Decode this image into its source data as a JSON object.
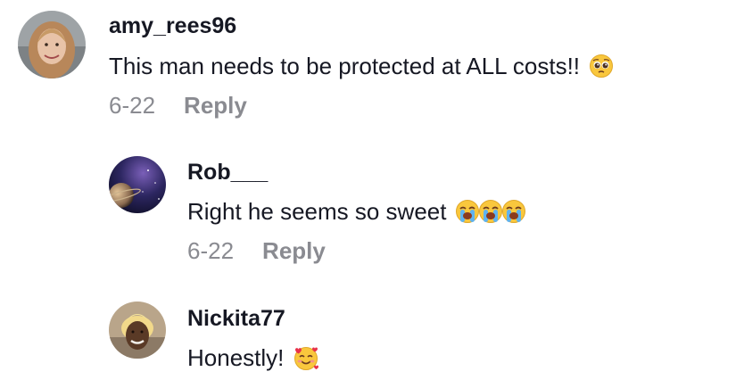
{
  "comments": [
    {
      "username": "amy_rees96",
      "text": "This man needs to be protected at ALL costs!!",
      "emoji": "pleading-face-icon",
      "date": "6-22",
      "reply_label": "Reply"
    },
    {
      "username": "Rob___",
      "text": "Right he seems so sweet",
      "emoji": "loudly-crying-face-icon",
      "emoji_count": 3,
      "date": "6-22",
      "reply_label": "Reply"
    },
    {
      "username": "Nickita77",
      "text": "Honestly!",
      "emoji": "smiling-face-with-hearts-icon"
    }
  ]
}
